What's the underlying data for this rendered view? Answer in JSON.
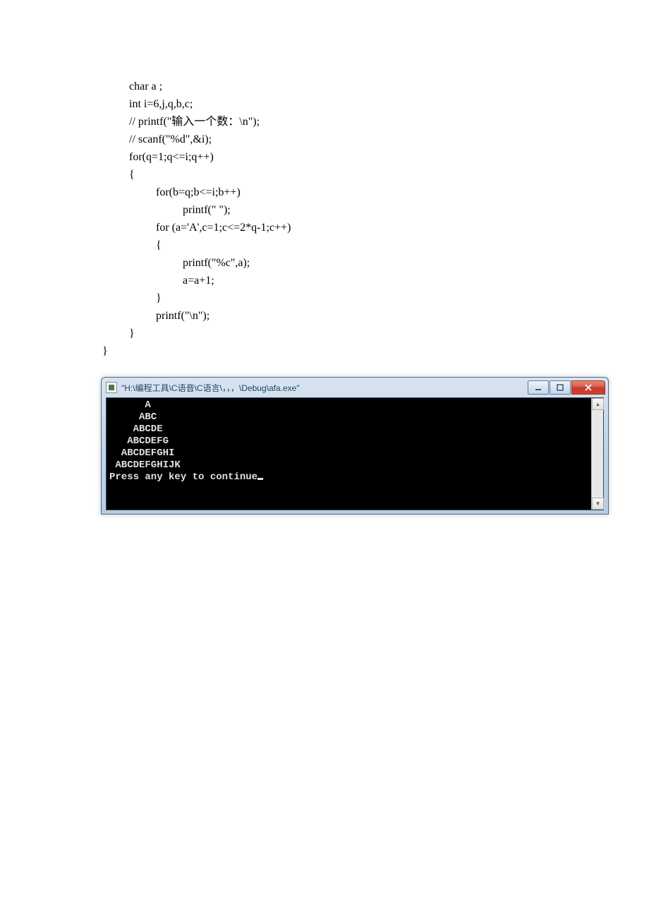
{
  "code": {
    "lines": [
      {
        "text": "char a ;",
        "indent": 0
      },
      {
        "text": "int i=6,j,q,b,c;",
        "indent": 0
      },
      {
        "text": "// printf(\"输入一个数：\\n\");",
        "indent": 0
      },
      {
        "text": "// scanf(\"%d\",&i);",
        "indent": 0
      },
      {
        "text": "for(q=1;q<=i;q++)",
        "indent": 0
      },
      {
        "text": "{",
        "indent": 0
      },
      {
        "text": "for(b=q;b<=i;b++)",
        "indent": 1
      },
      {
        "text": "printf(\" \");",
        "indent": 2
      },
      {
        "text": "for (a='A',c=1;c<=2*q-1;c++)",
        "indent": 1
      },
      {
        "text": "{",
        "indent": 1
      },
      {
        "text": "printf(\"%c\",a);",
        "indent": 2
      },
      {
        "text": "a=a+1;",
        "indent": 2
      },
      {
        "text": "}",
        "indent": 1
      },
      {
        "text": "printf(\"\\n\");",
        "indent": 1
      },
      {
        "text": "}",
        "indent": 0
      }
    ],
    "closing_brace": "}"
  },
  "console": {
    "title": "\"H:\\编程工具\\C语音\\C语言\\，，，\\Debug\\afa.exe\"",
    "output_lines": [
      "      A",
      "     ABC",
      "    ABCDE",
      "   ABCDEFG",
      "  ABCDEFGHI",
      " ABCDEFGHIJK"
    ],
    "prompt": "Press any key to continue"
  }
}
